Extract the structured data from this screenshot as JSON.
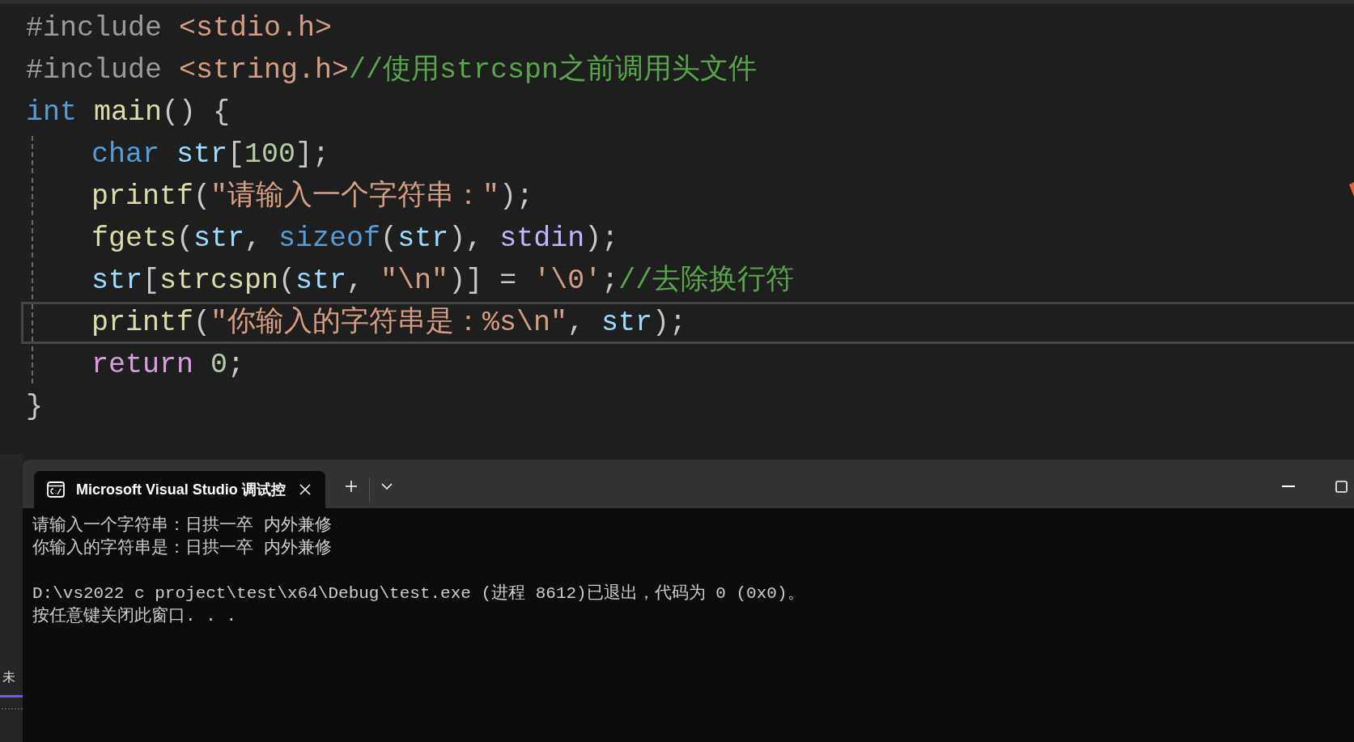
{
  "editor": {
    "lines": [
      {
        "indented": false,
        "current": false,
        "tokens": [
          {
            "kind": "pp",
            "text": "#include "
          },
          {
            "kind": "header",
            "text": "<stdio.h>"
          }
        ]
      },
      {
        "indented": false,
        "current": false,
        "tokens": [
          {
            "kind": "pp",
            "text": "#include "
          },
          {
            "kind": "header",
            "text": "<string.h>"
          },
          {
            "kind": "comment",
            "text": "//使用strcspn之前调用头文件"
          }
        ]
      },
      {
        "indented": false,
        "current": false,
        "tokens": [
          {
            "kind": "keyword",
            "text": "int "
          },
          {
            "kind": "function",
            "text": "main"
          },
          {
            "kind": "punct",
            "text": "() {"
          }
        ]
      },
      {
        "indented": true,
        "current": false,
        "tokens": [
          {
            "kind": "keyword",
            "text": "char "
          },
          {
            "kind": "variable",
            "text": "str"
          },
          {
            "kind": "punct",
            "text": "["
          },
          {
            "kind": "number",
            "text": "100"
          },
          {
            "kind": "punct",
            "text": "];"
          }
        ]
      },
      {
        "indented": true,
        "current": false,
        "tokens": [
          {
            "kind": "function",
            "text": "printf"
          },
          {
            "kind": "punct",
            "text": "("
          },
          {
            "kind": "string",
            "text": "\"请输入一个字符串：\""
          },
          {
            "kind": "punct",
            "text": ");"
          }
        ]
      },
      {
        "indented": true,
        "current": false,
        "tokens": [
          {
            "kind": "function",
            "text": "fgets"
          },
          {
            "kind": "punct",
            "text": "("
          },
          {
            "kind": "variable",
            "text": "str"
          },
          {
            "kind": "punct",
            "text": ", "
          },
          {
            "kind": "keyword",
            "text": "sizeof"
          },
          {
            "kind": "punct",
            "text": "("
          },
          {
            "kind": "variable",
            "text": "str"
          },
          {
            "kind": "punct",
            "text": "), "
          },
          {
            "kind": "macro",
            "text": "stdin"
          },
          {
            "kind": "punct",
            "text": ");"
          }
        ]
      },
      {
        "indented": true,
        "current": false,
        "tokens": [
          {
            "kind": "variable",
            "text": "str"
          },
          {
            "kind": "punct",
            "text": "["
          },
          {
            "kind": "function",
            "text": "strcspn"
          },
          {
            "kind": "punct",
            "text": "("
          },
          {
            "kind": "variable",
            "text": "str"
          },
          {
            "kind": "punct",
            "text": ", "
          },
          {
            "kind": "string",
            "text": "\"\\n\""
          },
          {
            "kind": "punct",
            "text": ")] = "
          },
          {
            "kind": "string",
            "text": "'\\0'"
          },
          {
            "kind": "punct",
            "text": ";"
          },
          {
            "kind": "comment",
            "text": "//去除换行符"
          }
        ]
      },
      {
        "indented": true,
        "current": true,
        "tokens": [
          {
            "kind": "function",
            "text": "printf"
          },
          {
            "kind": "punct",
            "text": "("
          },
          {
            "kind": "string",
            "text": "\"你输入的字符串是：%s\\n\""
          },
          {
            "kind": "punct",
            "text": ", "
          },
          {
            "kind": "variable",
            "text": "str"
          },
          {
            "kind": "punct",
            "text": ");"
          }
        ]
      },
      {
        "indented": true,
        "current": false,
        "tokens": [
          {
            "kind": "control",
            "text": "return "
          },
          {
            "kind": "number",
            "text": "0"
          },
          {
            "kind": "punct",
            "text": ";"
          }
        ]
      },
      {
        "indented": false,
        "current": false,
        "tokens": [
          {
            "kind": "punct",
            "text": "}"
          }
        ]
      }
    ]
  },
  "side_panel": {
    "labels": [
      "未"
    ]
  },
  "terminal": {
    "tab": {
      "title": "Microsoft Visual Studio 调试控",
      "selected": true
    },
    "output": [
      [
        "请输入一个字符串：日拱一卒 内外兼修",
        "你输入的字符串是：日拱一卒 内外兼修"
      ],
      [
        "D:\\vs2022 c project\\test\\x64\\Debug\\test.exe (进程 8612)已退出，代码为 0 (0x0)。",
        "按任意键关闭此窗口. . ."
      ]
    ]
  }
}
